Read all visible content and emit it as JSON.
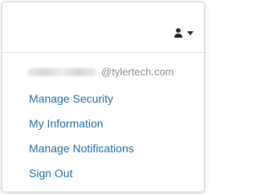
{
  "header": {
    "user_icon": "user-icon",
    "caret_icon": "caret-down-icon"
  },
  "account": {
    "domain": "@tylertech.com"
  },
  "menu": {
    "items": [
      {
        "label": "Manage Security"
      },
      {
        "label": "My Information"
      },
      {
        "label": "Manage Notifications"
      },
      {
        "label": "Sign Out"
      }
    ]
  },
  "colors": {
    "link": "#1f6fa8",
    "muted": "#8d8d8d",
    "icon": "#222222"
  }
}
